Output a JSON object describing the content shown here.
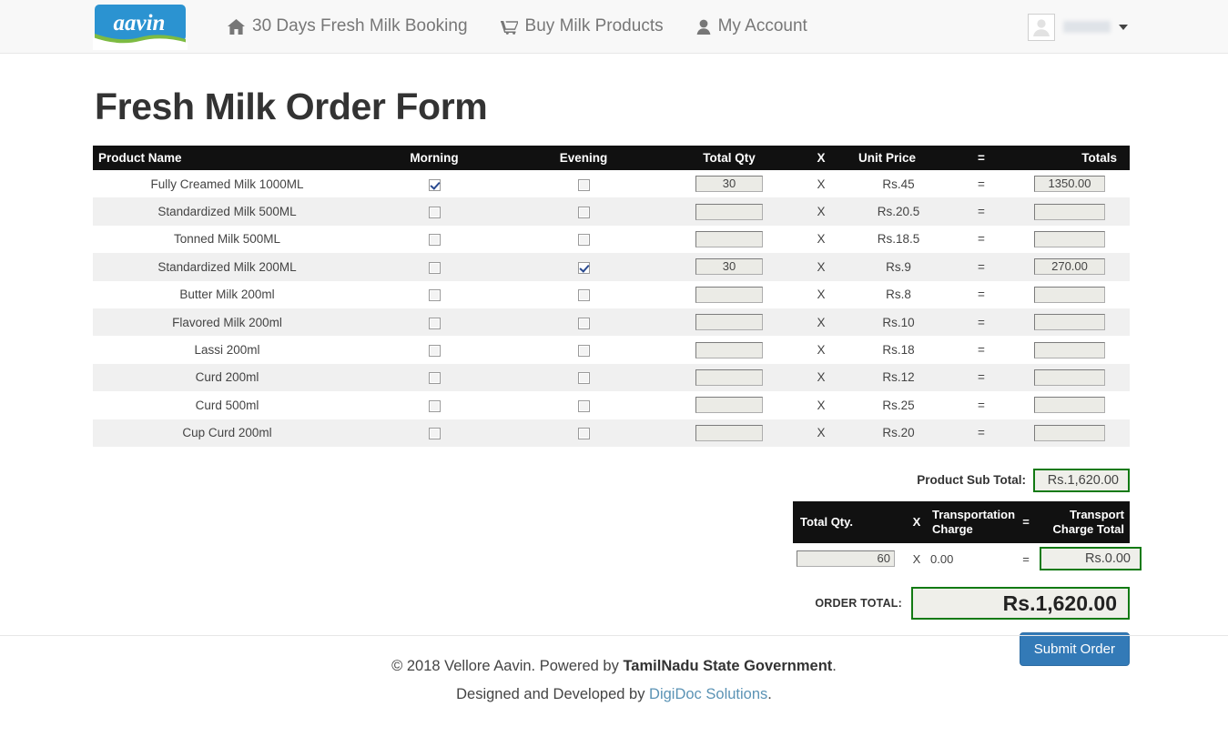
{
  "navbar": {
    "brand_alt": "aavin",
    "links": [
      {
        "label": "30 Days Fresh Milk Booking",
        "icon": "home-icon"
      },
      {
        "label": "Buy Milk Products",
        "icon": "cart-icon"
      },
      {
        "label": "My Account",
        "icon": "user-icon"
      }
    ],
    "account": {
      "username": "",
      "caret": "caret-down-icon"
    }
  },
  "page": {
    "title": "Fresh Milk Order Form"
  },
  "table": {
    "headers": {
      "product_name": "Product Name",
      "morning": "Morning",
      "evening": "Evening",
      "total_qty": "Total Qty",
      "times": "X",
      "unit_price": "Unit Price",
      "equals": "=",
      "totals": "Totals"
    },
    "rows": [
      {
        "name": "Fully Creamed Milk 1000ML",
        "morning": true,
        "evening": false,
        "qty": "30",
        "price": "Rs.45",
        "total": "1350.00"
      },
      {
        "name": "Standardized Milk 500ML",
        "morning": false,
        "evening": false,
        "qty": "",
        "price": "Rs.20.5",
        "total": ""
      },
      {
        "name": "Tonned Milk 500ML",
        "morning": false,
        "evening": false,
        "qty": "",
        "price": "Rs.18.5",
        "total": ""
      },
      {
        "name": "Standardized Milk 200ML",
        "morning": false,
        "evening": true,
        "qty": "30",
        "price": "Rs.9",
        "total": "270.00"
      },
      {
        "name": "Butter Milk 200ml",
        "morning": false,
        "evening": false,
        "qty": "",
        "price": "Rs.8",
        "total": ""
      },
      {
        "name": "Flavored Milk 200ml",
        "morning": false,
        "evening": false,
        "qty": "",
        "price": "Rs.10",
        "total": ""
      },
      {
        "name": "Lassi 200ml",
        "morning": false,
        "evening": false,
        "qty": "",
        "price": "Rs.18",
        "total": ""
      },
      {
        "name": "Curd 200ml",
        "morning": false,
        "evening": false,
        "qty": "",
        "price": "Rs.12",
        "total": ""
      },
      {
        "name": "Curd 500ml",
        "morning": false,
        "evening": false,
        "qty": "",
        "price": "Rs.25",
        "total": ""
      },
      {
        "name": "Cup Curd 200ml",
        "morning": false,
        "evening": false,
        "qty": "",
        "price": "Rs.20",
        "total": ""
      }
    ]
  },
  "summary": {
    "subtotal_label": "Product Sub Total:",
    "subtotal_value": "Rs.1,620.00",
    "transport": {
      "header_total_qty": "Total Qty.",
      "header_times": "X",
      "header_charge": "Transportation Charge",
      "header_equals": "=",
      "header_charge_total": "Transport Charge Total",
      "total_qty_value": "60",
      "times": "X",
      "charge_value": "0.00",
      "equals": "=",
      "charge_total_value": "Rs.0.00"
    },
    "order_total_label": "ORDER TOTAL:",
    "order_total_value": "Rs.1,620.00",
    "submit_label": "Submit Order"
  },
  "footer": {
    "line1_prefix": "© 2018 Vellore Aavin. Powered by ",
    "line1_strong": "TamilNadu State Government",
    "line1_suffix": ".",
    "line2_prefix": "Designed and Developed by ",
    "line2_link": "DigiDoc Solutions",
    "line2_suffix": "."
  },
  "colors": {
    "header_black": "#111111",
    "accent_green": "#127a13",
    "button_blue": "#337ab7",
    "link_blue": "#5b93b5",
    "logo_blue": "#2b93d1"
  }
}
